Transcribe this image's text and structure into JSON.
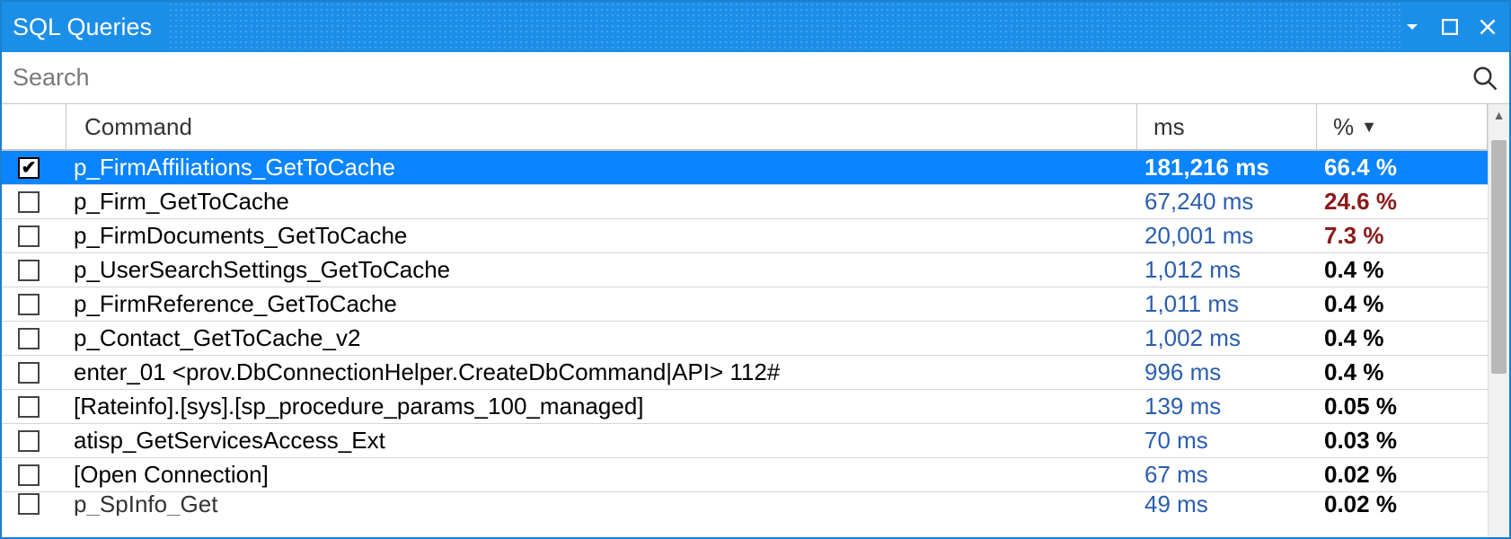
{
  "window": {
    "title": "SQL Queries"
  },
  "search": {
    "placeholder": "Search"
  },
  "columns": {
    "command": "Command",
    "ms": "ms",
    "percent": "%"
  },
  "sort": {
    "column": "percent",
    "indicator": "▼"
  },
  "rows": [
    {
      "selected": true,
      "checked": true,
      "command": "p_FirmAffiliations_GetToCache",
      "ms": "181,216 ms",
      "percent": "66.4 %",
      "pct_high": false
    },
    {
      "selected": false,
      "checked": false,
      "command": "p_Firm_GetToCache",
      "ms": "67,240 ms",
      "percent": "24.6 %",
      "pct_high": true
    },
    {
      "selected": false,
      "checked": false,
      "command": "p_FirmDocuments_GetToCache",
      "ms": "20,001 ms",
      "percent": "7.3 %",
      "pct_high": true
    },
    {
      "selected": false,
      "checked": false,
      "command": "p_UserSearchSettings_GetToCache",
      "ms": "1,012 ms",
      "percent": "0.4 %",
      "pct_high": false
    },
    {
      "selected": false,
      "checked": false,
      "command": "p_FirmReference_GetToCache",
      "ms": "1,011 ms",
      "percent": "0.4 %",
      "pct_high": false
    },
    {
      "selected": false,
      "checked": false,
      "command": "p_Contact_GetToCache_v2",
      "ms": "1,002 ms",
      "percent": "0.4 %",
      "pct_high": false
    },
    {
      "selected": false,
      "checked": false,
      "command": "enter_01 <prov.DbConnectionHelper.CreateDbCommand|API> 112#",
      "ms": "996 ms",
      "percent": "0.4 %",
      "pct_high": false
    },
    {
      "selected": false,
      "checked": false,
      "command": "[Rateinfo].[sys].[sp_procedure_params_100_managed]",
      "ms": "139 ms",
      "percent": "0.05 %",
      "pct_high": false
    },
    {
      "selected": false,
      "checked": false,
      "command": "atisp_GetServicesAccess_Ext",
      "ms": "70 ms",
      "percent": "0.03 %",
      "pct_high": false
    },
    {
      "selected": false,
      "checked": false,
      "command": "[Open Connection]",
      "ms": "67 ms",
      "percent": "0.02 %",
      "pct_high": false
    },
    {
      "selected": false,
      "checked": false,
      "command": "p_SpInfo_Get",
      "ms": "49 ms",
      "percent": "0.02 %",
      "pct_high": false,
      "partial": true
    }
  ]
}
